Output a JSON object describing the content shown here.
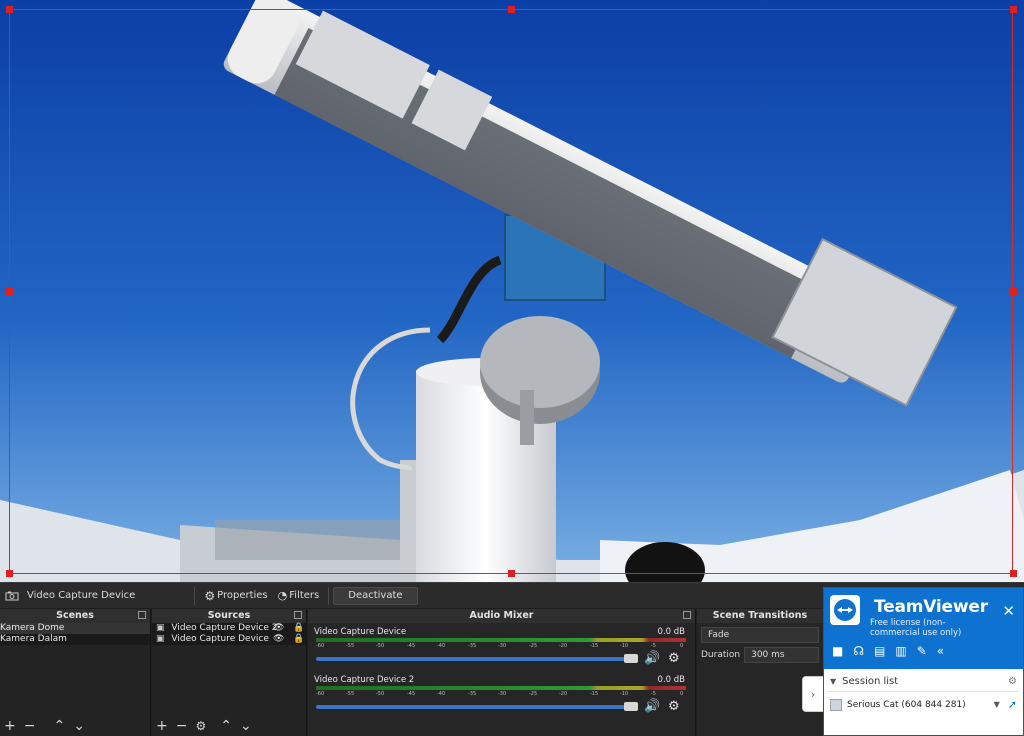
{
  "toolbar": {
    "source_name": "Video Capture Device",
    "properties_label": "Properties",
    "filters_label": "Filters",
    "deactivate_label": "Deactivate"
  },
  "scenes": {
    "title": "Scenes",
    "items": [
      "Kamera Dome",
      "Kamera Dalam"
    ]
  },
  "sources": {
    "title": "Sources",
    "items": [
      "Video Capture Device 2",
      "Video Capture Device"
    ]
  },
  "mixer": {
    "title": "Audio Mixer",
    "channels": [
      {
        "name": "Video Capture Device",
        "db": "0.0 dB"
      },
      {
        "name": "Video Capture Device 2",
        "db": "0.0 dB"
      }
    ],
    "ticks": [
      "-60",
      "-55",
      "-50",
      "-45",
      "-40",
      "-35",
      "-30",
      "-25",
      "-20",
      "-15",
      "-10",
      "-5",
      "0"
    ]
  },
  "transitions": {
    "title": "Scene Transitions",
    "selected": "Fade",
    "duration_label": "Duration",
    "duration_value": "300 ms"
  },
  "teamviewer": {
    "title": "TeamViewer",
    "subtitle": "Free license (non-commercial use only)",
    "session_list_label": "Session list",
    "session_entry": "Serious Cat (604 844 281)"
  },
  "colors": {
    "selection": "#d42a2a",
    "teamviewer_blue": "#0e72d1",
    "volume_slider": "#3a75c9"
  }
}
